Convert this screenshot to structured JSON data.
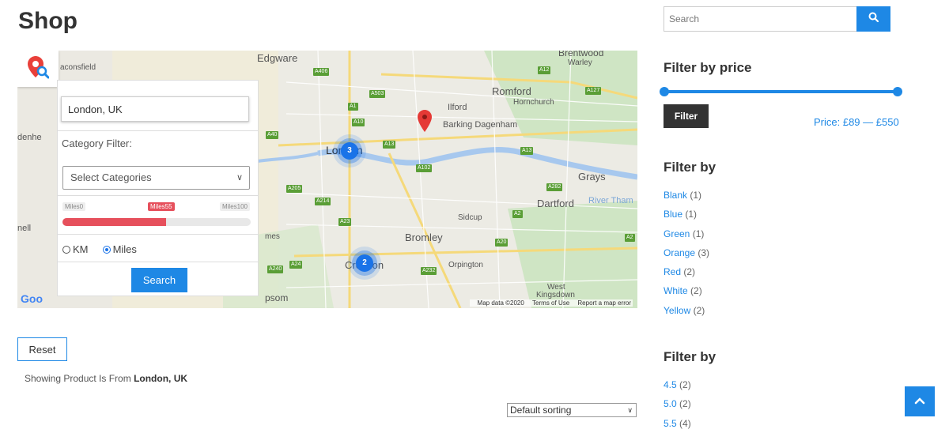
{
  "page": {
    "title": "Shop"
  },
  "map": {
    "labels": {
      "edgware": "Edgware",
      "brentwood": "Brentwood",
      "warley": "Warley",
      "beaconsfield": "aconsfield",
      "romford": "Romford",
      "hornchurch": "Hornchurch",
      "ilford": "Ilford",
      "barking": "Barking Dagenham",
      "london": "London",
      "grays": "Grays",
      "dartford": "Dartford",
      "river": "River Tham",
      "sidcup": "Sidcup",
      "bromley": "Bromley",
      "orpington": "Orpington",
      "croydon": "Croydon",
      "west_kingsdown": "West",
      "kingsdown": "Kingsdown",
      "epsom": "psom",
      "denhe": "denhe",
      "nell": "nell",
      "mes": "mes"
    },
    "clusters": [
      "3",
      "2"
    ],
    "footer": {
      "data": "Map data ©2020",
      "terms": "Terms of Use",
      "report": "Report a map error"
    },
    "google": "Goo"
  },
  "filter_panel": {
    "location_value": "London, UK",
    "category_label": "Category Filter:",
    "category_select": "Select Categories",
    "radius": {
      "min_label": "Miles0",
      "current_label": "Miles55",
      "max_label": "Miles100",
      "value": 55,
      "max": 100
    },
    "units": {
      "km": "KM",
      "miles": "Miles",
      "selected": "Miles"
    },
    "search_label": "Search"
  },
  "reset_label": "Reset",
  "showing": {
    "prefix": "Showing Product Is From",
    "location": "London, UK"
  },
  "sorting": {
    "selected": "Default sorting"
  },
  "sidebar": {
    "search_placeholder": "Search",
    "price": {
      "title": "Filter by price",
      "button": "Filter",
      "text": "Price: £89 — £550"
    },
    "color_filter": {
      "title": "Filter by",
      "items": [
        {
          "label": "Blank",
          "count": "(1)"
        },
        {
          "label": "Blue",
          "count": "(1)"
        },
        {
          "label": "Green",
          "count": "(1)"
        },
        {
          "label": "Orange",
          "count": "(3)"
        },
        {
          "label": "Red",
          "count": "(2)"
        },
        {
          "label": "White",
          "count": "(2)"
        },
        {
          "label": "Yellow",
          "count": "(2)"
        }
      ]
    },
    "size_filter": {
      "title": "Filter by",
      "items": [
        {
          "label": "4.5",
          "count": "(2)"
        },
        {
          "label": "5.0",
          "count": "(2)"
        },
        {
          "label": "5.5",
          "count": "(4)"
        }
      ]
    }
  },
  "colors": {
    "accent": "#1e88e5",
    "slider_red": "#e6505c",
    "dark_button": "#333333"
  },
  "icons": {
    "locate": "map-pin-search-icon",
    "search": "search-icon",
    "back_to_top": "chevron-up-icon",
    "marker": "map-marker-icon"
  }
}
